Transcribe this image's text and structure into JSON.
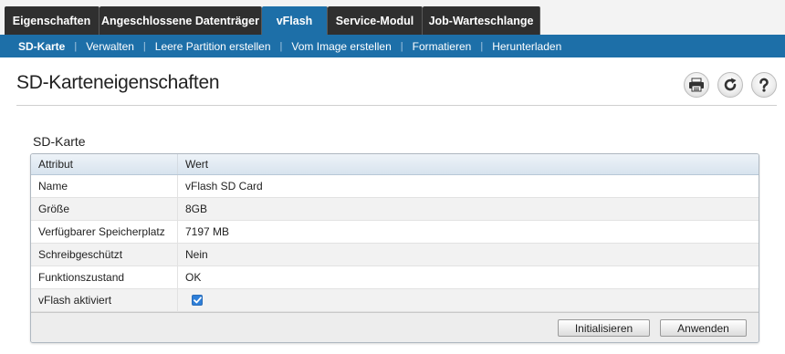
{
  "tabs": [
    {
      "label": "Eigenschaften",
      "active": false
    },
    {
      "label": "Angeschlossene Datenträger",
      "active": false
    },
    {
      "label": "vFlash",
      "active": true
    },
    {
      "label": "Service-Modul",
      "active": false
    },
    {
      "label": "Job-Warteschlange",
      "active": false
    }
  ],
  "subnav": [
    {
      "label": "SD-Karte",
      "active": true
    },
    {
      "label": "Verwalten",
      "active": false
    },
    {
      "label": "Leere Partition erstellen",
      "active": false
    },
    {
      "label": "Vom Image erstellen",
      "active": false
    },
    {
      "label": "Formatieren",
      "active": false
    },
    {
      "label": "Herunterladen",
      "active": false
    }
  ],
  "page": {
    "title": "SD-Karteneigenschaften"
  },
  "toolbar_icons": [
    "print-icon",
    "refresh-icon",
    "help-icon"
  ],
  "section": {
    "title": "SD-Karte"
  },
  "table": {
    "headers": [
      "Attribut",
      "Wert"
    ],
    "rows": [
      {
        "attr": "Name",
        "value": "vFlash SD Card"
      },
      {
        "attr": "Größe",
        "value": "8GB"
      },
      {
        "attr": "Verfügbarer Speicherplatz",
        "value": "7197 MB"
      },
      {
        "attr": "Schreibgeschützt",
        "value": "Nein"
      },
      {
        "attr": "Funktionszustand",
        "value": "OK"
      },
      {
        "attr": "vFlash aktiviert",
        "checked": true
      }
    ]
  },
  "buttons": {
    "initialize": "Initialisieren",
    "apply": "Anwenden"
  },
  "colors": {
    "accent": "#1d6fa8",
    "tab_dark": "#2f2f2f",
    "checkbox": "#2f7fd8"
  }
}
